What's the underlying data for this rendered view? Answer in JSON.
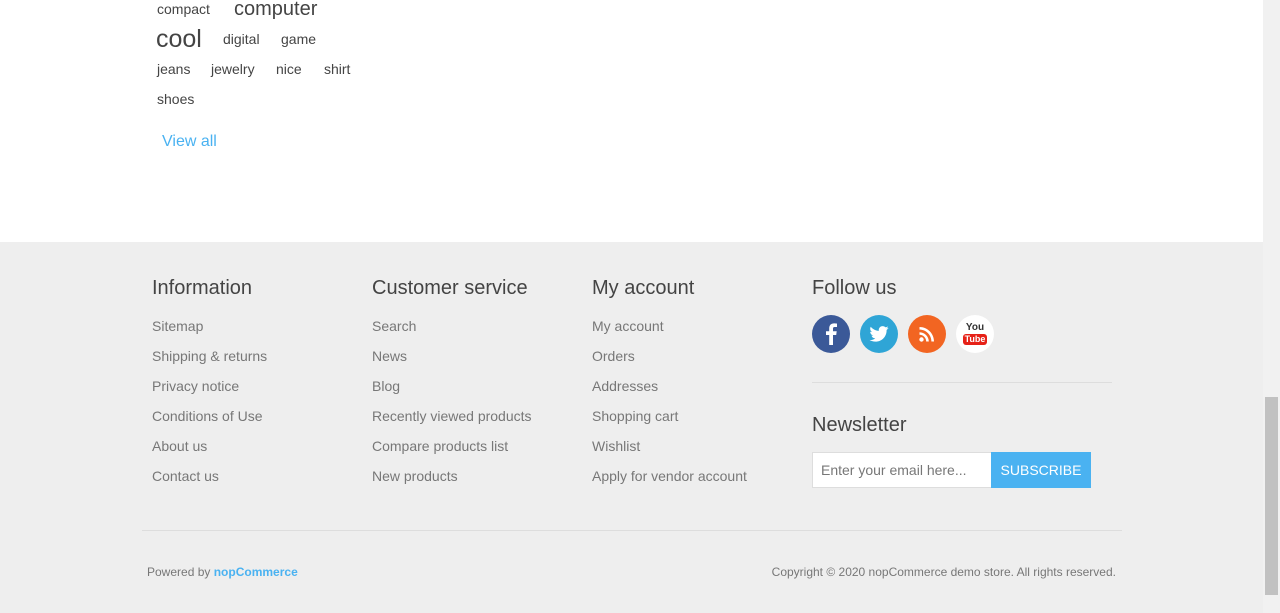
{
  "tags": {
    "items": [
      {
        "label": "compact"
      },
      {
        "label": "computer"
      },
      {
        "label": "cool"
      },
      {
        "label": "digital"
      },
      {
        "label": "game"
      },
      {
        "label": "jeans"
      },
      {
        "label": "jewelry"
      },
      {
        "label": "nice"
      },
      {
        "label": "shirt"
      },
      {
        "label": "shoes"
      }
    ],
    "view_all": "View all"
  },
  "footer": {
    "information": {
      "title": "Information",
      "links": [
        "Sitemap",
        "Shipping & returns",
        "Privacy notice",
        "Conditions of Use",
        "About us",
        "Contact us"
      ]
    },
    "customer_service": {
      "title": "Customer service",
      "links": [
        "Search",
        "News",
        "Blog",
        "Recently viewed products",
        "Compare products list",
        "New products"
      ]
    },
    "my_account": {
      "title": "My account",
      "links": [
        "My account",
        "Orders",
        "Addresses",
        "Shopping cart",
        "Wishlist",
        "Apply for vendor account"
      ]
    },
    "follow_us": {
      "title": "Follow us",
      "icons": [
        "facebook-icon",
        "twitter-icon",
        "rss-icon",
        "youtube-icon"
      ],
      "youtube_you": "You",
      "youtube_tube": "Tube"
    },
    "newsletter": {
      "title": "Newsletter",
      "placeholder": "Enter your email here...",
      "button": "SUBSCRIBE"
    },
    "powered_label": "Powered by",
    "powered_link": "nopCommerce",
    "copyright": "Copyright © 2020 nopCommerce demo store. All rights reserved."
  },
  "colors": {
    "accent": "#4ab2f1",
    "footer_bg": "#eeeeee",
    "facebook": "#3b5998",
    "twitter": "#2fa5d6",
    "rss": "#f26522",
    "youtube": "#e62117"
  }
}
